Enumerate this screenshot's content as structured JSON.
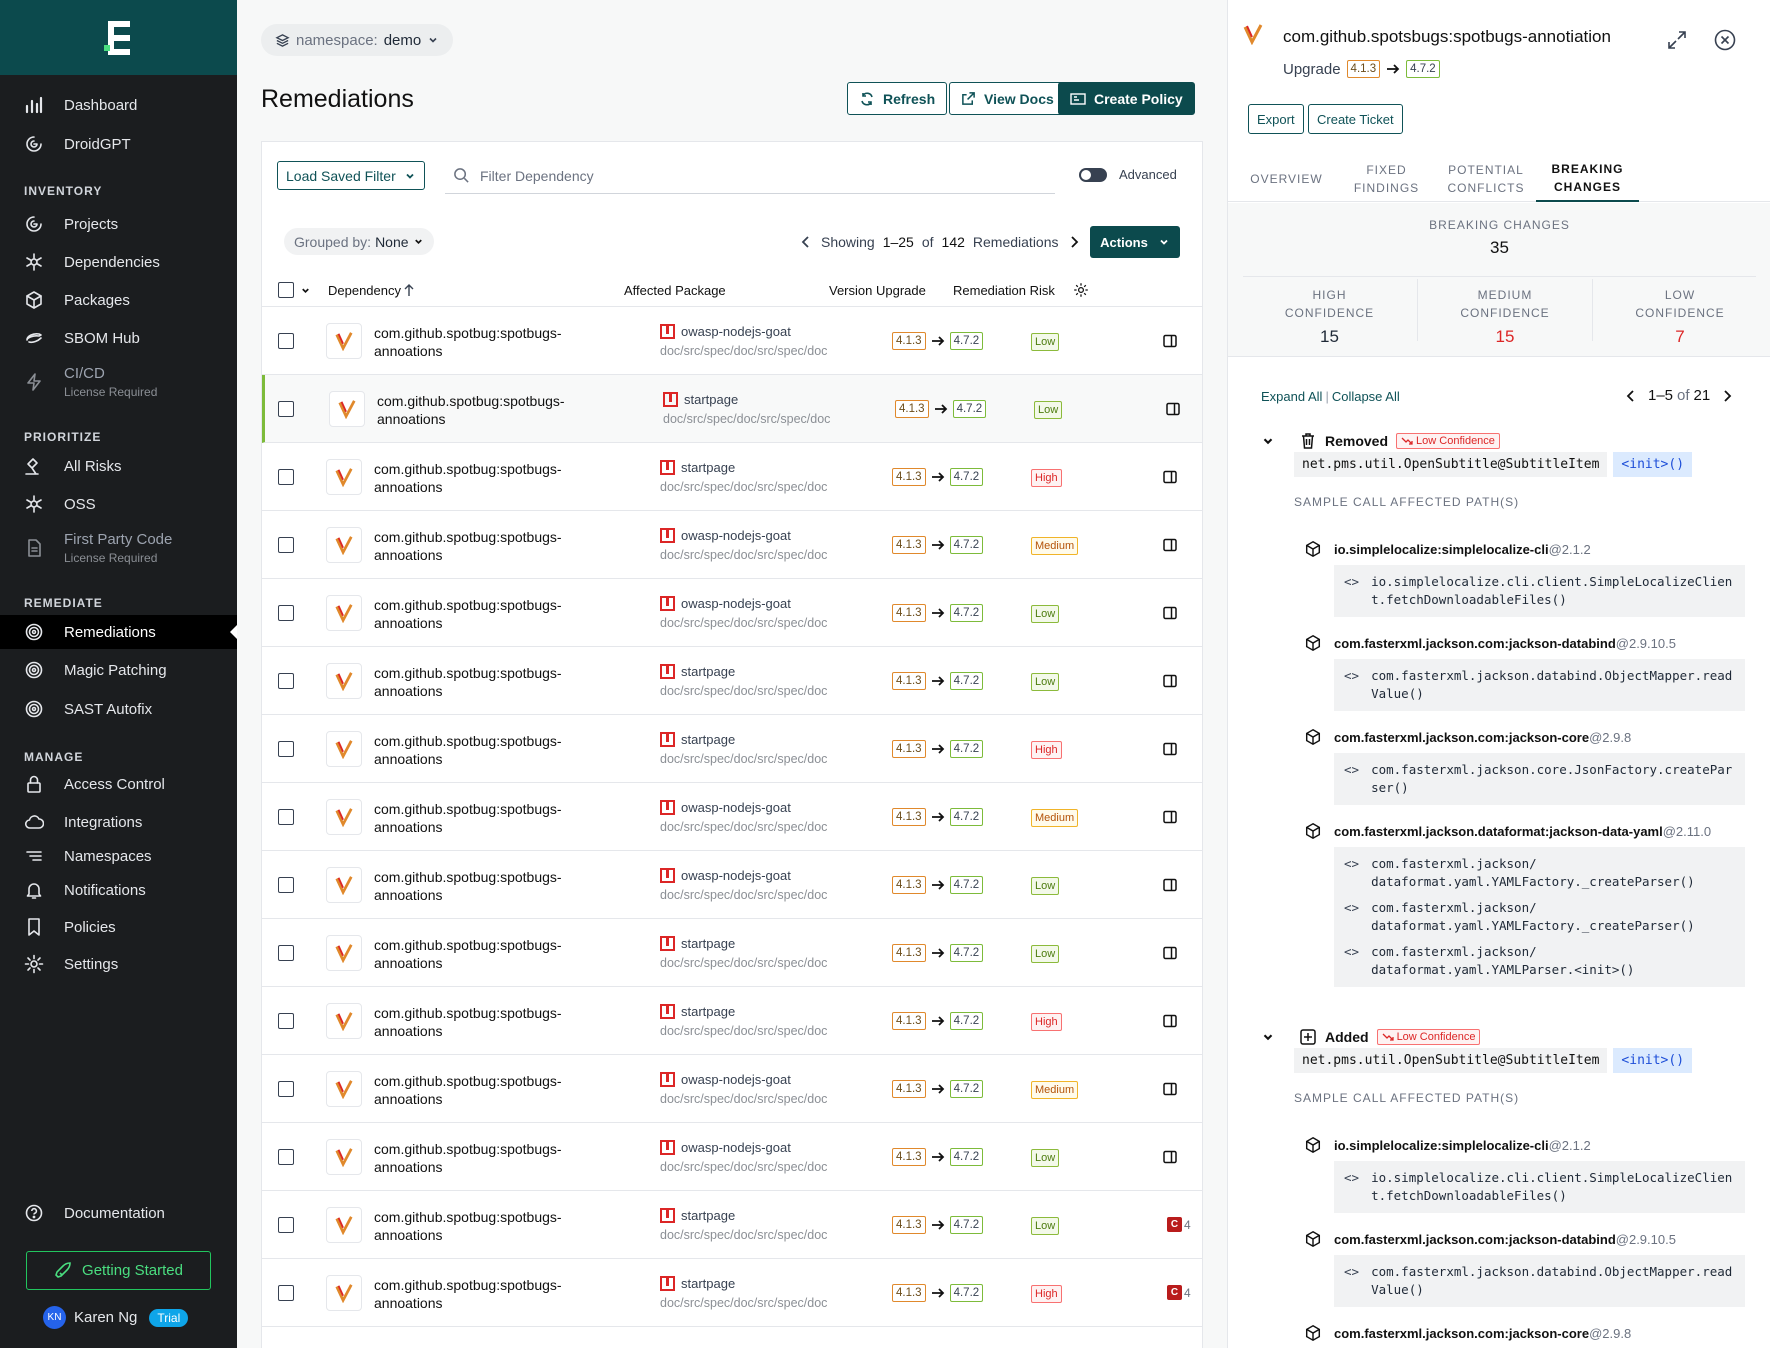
{
  "sidebar": {
    "nav_top": [
      {
        "label": "Dashboard",
        "icon": "bar-chart-icon"
      },
      {
        "label": "DroidGPT",
        "icon": "droid-icon"
      }
    ],
    "sections": [
      {
        "title": "INVENTORY",
        "items": [
          {
            "label": "Projects",
            "icon": "projects-icon"
          },
          {
            "label": "Dependencies",
            "icon": "dependencies-icon"
          },
          {
            "label": "Packages",
            "icon": "package-icon"
          },
          {
            "label": "SBOM Hub",
            "icon": "sbom-icon"
          },
          {
            "label": "CI/CD",
            "sub": "License Required",
            "icon": "lightning-icon"
          }
        ]
      },
      {
        "title": "PRIORITIZE",
        "items": [
          {
            "label": "All Risks",
            "icon": "risk-icon"
          },
          {
            "label": "OSS",
            "icon": "oss-icon"
          },
          {
            "label": "First Party Code",
            "sub": "License Required",
            "icon": "document-icon"
          }
        ]
      },
      {
        "title": "REMEDIATE",
        "items": [
          {
            "label": "Remediations",
            "icon": "target-icon",
            "active": true
          },
          {
            "label": "Magic Patching",
            "icon": "target-icon"
          },
          {
            "label": "SAST Autofix",
            "icon": "target-icon"
          }
        ]
      },
      {
        "title": "MANAGE",
        "items": [
          {
            "label": "Access Control",
            "icon": "lock-icon"
          },
          {
            "label": "Integrations",
            "icon": "cloud-icon"
          },
          {
            "label": "Namespaces",
            "icon": "list-icon"
          },
          {
            "label": "Notifications",
            "icon": "bell-icon"
          },
          {
            "label": "Policies",
            "icon": "bookmark-icon"
          },
          {
            "label": "Settings",
            "icon": "gear-icon"
          }
        ]
      }
    ],
    "documentation": "Documentation",
    "getting_started": "Getting Started",
    "user": {
      "initials": "KN",
      "name": "Karen Ng",
      "badge": "Trial"
    }
  },
  "main": {
    "namespace_label": "namespace:",
    "namespace_value": "demo",
    "title": "Remediations",
    "buttons": {
      "refresh": "Refresh",
      "view_docs": "View Docs",
      "create_policy": "Create Policy"
    },
    "load_saved_filter": "Load Saved Filter",
    "filter_placeholder": "Filter Dependency",
    "advanced": "Advanced",
    "grouped_by_label": "Grouped by:",
    "grouped_by_value": "None",
    "pager": {
      "showing": "Showing",
      "range": "1–25",
      "of": "of",
      "total": "142",
      "unit": "Remediations"
    },
    "actions": "Actions",
    "columns": {
      "dependency": "Dependency",
      "affected_package": "Affected Package",
      "version_upgrade": "Version Upgrade",
      "remediation_risk": "Remediation Risk"
    },
    "rows": [
      {
        "dep_line1": "com.github.spotbug:spotbugs-",
        "dep_line2": "annoations",
        "package": "owasp-nodejs-goat",
        "path": "doc/src/spec/doc/src/spec/doc",
        "from": "4.1.3",
        "to": "4.7.2",
        "risk": "Low"
      },
      {
        "dep_line1": "com.github.spotbug:spotbugs-",
        "dep_line2": "annoations",
        "package": "startpage",
        "path": "doc/src/spec/doc/src/spec/doc",
        "from": "4.1.3",
        "to": "4.7.2",
        "risk": "Low",
        "selected": true
      },
      {
        "dep_line1": "com.github.spotbug:spotbugs-",
        "dep_line2": "annoations",
        "package": "startpage",
        "path": "doc/src/spec/doc/src/spec/doc",
        "from": "4.1.3",
        "to": "4.7.2",
        "risk": "High"
      },
      {
        "dep_line1": "com.github.spotbug:spotbugs-",
        "dep_line2": "annoations",
        "package": "owasp-nodejs-goat",
        "path": "doc/src/spec/doc/src/spec/doc",
        "from": "4.1.3",
        "to": "4.7.2",
        "risk": "Medium"
      },
      {
        "dep_line1": "com.github.spotbug:spotbugs-",
        "dep_line2": "annoations",
        "package": "owasp-nodejs-goat",
        "path": "doc/src/spec/doc/src/spec/doc",
        "from": "4.1.3",
        "to": "4.7.2",
        "risk": "Low"
      },
      {
        "dep_line1": "com.github.spotbug:spotbugs-",
        "dep_line2": "annoations",
        "package": "startpage",
        "path": "doc/src/spec/doc/src/spec/doc",
        "from": "4.1.3",
        "to": "4.7.2",
        "risk": "Low"
      },
      {
        "dep_line1": "com.github.spotbug:spotbugs-",
        "dep_line2": "annoations",
        "package": "startpage",
        "path": "doc/src/spec/doc/src/spec/doc",
        "from": "4.1.3",
        "to": "4.7.2",
        "risk": "High"
      },
      {
        "dep_line1": "com.github.spotbug:spotbugs-",
        "dep_line2": "annoations",
        "package": "owasp-nodejs-goat",
        "path": "doc/src/spec/doc/src/spec/doc",
        "from": "4.1.3",
        "to": "4.7.2",
        "risk": "Medium"
      },
      {
        "dep_line1": "com.github.spotbug:spotbugs-",
        "dep_line2": "annoations",
        "package": "owasp-nodejs-goat",
        "path": "doc/src/spec/doc/src/spec/doc",
        "from": "4.1.3",
        "to": "4.7.2",
        "risk": "Low"
      },
      {
        "dep_line1": "com.github.spotbug:spotbugs-",
        "dep_line2": "annoations",
        "package": "startpage",
        "path": "doc/src/spec/doc/src/spec/doc",
        "from": "4.1.3",
        "to": "4.7.2",
        "risk": "Low"
      },
      {
        "dep_line1": "com.github.spotbug:spotbugs-",
        "dep_line2": "annoations",
        "package": "startpage",
        "path": "doc/src/spec/doc/src/spec/doc",
        "from": "4.1.3",
        "to": "4.7.2",
        "risk": "High"
      },
      {
        "dep_line1": "com.github.spotbug:spotbugs-",
        "dep_line2": "annoations",
        "package": "owasp-nodejs-goat",
        "path": "doc/src/spec/doc/src/spec/doc",
        "from": "4.1.3",
        "to": "4.7.2",
        "risk": "Medium"
      },
      {
        "dep_line1": "com.github.spotbug:spotbugs-",
        "dep_line2": "annoations",
        "package": "owasp-nodejs-goat",
        "path": "doc/src/spec/doc/src/spec/doc",
        "from": "4.1.3",
        "to": "4.7.2",
        "risk": "Low"
      },
      {
        "dep_line1": "com.github.spotbug:spotbugs-",
        "dep_line2": "annoations",
        "package": "startpage",
        "path": "doc/src/spec/doc/src/spec/doc",
        "from": "4.1.3",
        "to": "4.7.2",
        "risk": "Low",
        "badge": "4"
      },
      {
        "dep_line1": "com.github.spotbug:spotbugs-",
        "dep_line2": "annoations",
        "package": "startpage",
        "path": "doc/src/spec/doc/src/spec/doc",
        "from": "4.1.3",
        "to": "4.7.2",
        "risk": "High",
        "badge": "4"
      }
    ]
  },
  "panel": {
    "title": "com.github.spotsbugs:spotbugs-annotiation",
    "upgrade_label": "Upgrade",
    "from": "4.1.3",
    "to": "4.7.2",
    "export": "Export",
    "create_ticket": "Create Ticket",
    "tabs": [
      {
        "line1": "OVERVIEW",
        "line2": ""
      },
      {
        "line1": "FIXED",
        "line2": "FINDINGS"
      },
      {
        "line1": "POTENTIAL",
        "line2": "CONFLICTS"
      },
      {
        "line1": "BREAKING",
        "line2": "CHANGES",
        "active": true
      }
    ],
    "breaking_changes_label": "BREAKING CHANGES",
    "breaking_changes_total": "35",
    "confidence": [
      {
        "line1": "HIGH",
        "line2": "CONFIDENCE",
        "value": "15",
        "color": "#1f2937"
      },
      {
        "line1": "MEDIUM",
        "line2": "CONFIDENCE",
        "value": "15",
        "color": "#dc2626"
      },
      {
        "line1": "LOW",
        "line2": "CONFIDENCE",
        "value": "7",
        "color": "#dc2626"
      }
    ],
    "expand_all": "Expand All",
    "collapse_all": "Collapse All",
    "pager": {
      "range": "1–5",
      "of": "of",
      "total": "21"
    },
    "sample_label": "SAMPLE CALL AFFECTED PATH(S)",
    "removed": {
      "label": "Removed",
      "confidence": "Low Confidence",
      "class_sig": "net.pms.util.OpenSubtitle@SubtitleItem",
      "method_sig": "<init>()",
      "libs": [
        {
          "name": "io.simplelocalize:simplelocalize-cli",
          "version": "@2.1.2",
          "calls": [
            "io.simplelocalize.cli.client.SimpleLocalizeClient.fetchDownloadableFiles()"
          ]
        },
        {
          "name": "com.fasterxml.jackson.com:jackson-databind",
          "version": "@2.9.10.5",
          "calls": [
            "com.fasterxml.jackson.databind.ObjectMapper.readValue()"
          ]
        },
        {
          "name": "com.fasterxml.jackson.com:jackson-core",
          "version": "@2.9.8",
          "calls": [
            "com.fasterxml.jackson.core.JsonFactory.createParser()"
          ]
        },
        {
          "name": "com.fasterxml.jackson.dataformat:jackson-data-yaml",
          "version": "@2.11.0",
          "calls": [
            "com.fasterxml.jackson/\ndataformat.yaml.YAMLFactory._createParser()",
            "com.fasterxml.jackson/\ndataformat.yaml.YAMLFactory._createParser()",
            "com.fasterxml.jackson/\ndataformat.yaml.YAMLParser.<init>()"
          ]
        }
      ]
    },
    "added": {
      "label": "Added",
      "confidence": "Low Confidence",
      "class_sig": "net.pms.util.OpenSubtitle@SubtitleItem",
      "method_sig": "<init>()",
      "libs": [
        {
          "name": "io.simplelocalize:simplelocalize-cli",
          "version": "@2.1.2",
          "calls": [
            "io.simplelocalize.cli.client.SimpleLocalizeClient.fetchDownloadableFiles()"
          ]
        },
        {
          "name": "com.fasterxml.jackson.com:jackson-databind",
          "version": "@2.9.10.5",
          "calls": [
            "com.fasterxml.jackson.databind.ObjectMapper.readValue()"
          ]
        },
        {
          "name": "com.fasterxml.jackson.com:jackson-core",
          "version": "@2.9.8",
          "calls": []
        }
      ]
    }
  },
  "colors": {
    "brand": "#0c4a4d",
    "sidebar_bg": "#1b1d1f",
    "risk_low": "#8cba3b",
    "risk_high": "#dc2626",
    "risk_medium": "#f0b429"
  }
}
